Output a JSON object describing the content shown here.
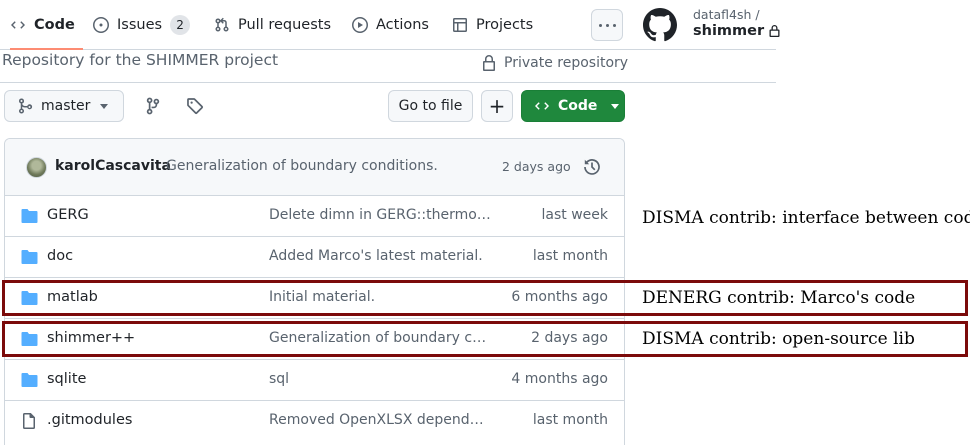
{
  "nav": {
    "tabs": [
      {
        "label": "Code",
        "icon": "code-icon",
        "active": true
      },
      {
        "label": "Issues",
        "icon": "issue-opened-icon",
        "count": "2"
      },
      {
        "label": "Pull requests",
        "icon": "git-pull-request-icon"
      },
      {
        "label": "Actions",
        "icon": "play-icon"
      },
      {
        "label": "Projects",
        "icon": "table-icon"
      }
    ],
    "owner": "datafl4sh /",
    "repo": "shimmer"
  },
  "repo": {
    "description": "Repository for the SHIMMER project",
    "visibility": "Private repository"
  },
  "toolbar": {
    "branch": "master",
    "goto_label": "Go to file",
    "add_label": "+",
    "code_label": "Code"
  },
  "commit": {
    "author": "karolCascavita",
    "message": "Generalization of boundary conditions.",
    "time": "2 days ago"
  },
  "files": [
    {
      "name": "GERG",
      "type": "folder",
      "message": "Delete dimn in GERG::thermodynamics...",
      "time": "last week"
    },
    {
      "name": "doc",
      "type": "folder",
      "message": "Added Marco's latest material.",
      "time": "last month"
    },
    {
      "name": "matlab",
      "type": "folder",
      "message": "Initial material.",
      "time": "6 months ago"
    },
    {
      "name": "shimmer++",
      "type": "folder",
      "message": "Generalization of boundary conditions.",
      "time": "2 days ago"
    },
    {
      "name": "sqlite",
      "type": "folder",
      "message": "sql",
      "time": "4 months ago"
    },
    {
      "name": ".gitmodules",
      "type": "file",
      "message": "Removed OpenXLSX dependency",
      "time": "last month"
    }
  ],
  "annotations": [
    "DISMA contrib: interface between codes",
    "DENERG contrib: Marco's code",
    "DISMA contrib: open-source lib"
  ],
  "colors": {
    "accent_green": "#1f883d",
    "folder_blue": "#54aeff",
    "highlight_red": "#7b0a0a",
    "tab_underline": "#fd8c73"
  }
}
